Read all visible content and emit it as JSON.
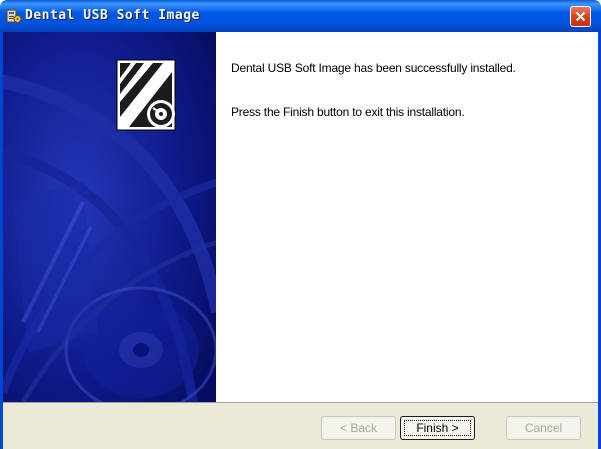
{
  "window": {
    "title": "Dental USB Soft Image",
    "title_icon": "installer-icon",
    "close_icon": "close-icon"
  },
  "content": {
    "message_line1": "Dental USB Soft Image has been successfully installed.",
    "message_line2": "Press the Finish button to exit this installation."
  },
  "buttons": {
    "back": {
      "label": "< Back",
      "enabled": false
    },
    "finish": {
      "label": "Finish >",
      "enabled": true,
      "focused": true
    },
    "cancel": {
      "label": "Cancel",
      "enabled": false
    }
  },
  "colors": {
    "titlebar": "#0054e3",
    "banner": "#06106e",
    "button_face": "#ece9d8",
    "close": "#d9441d"
  }
}
